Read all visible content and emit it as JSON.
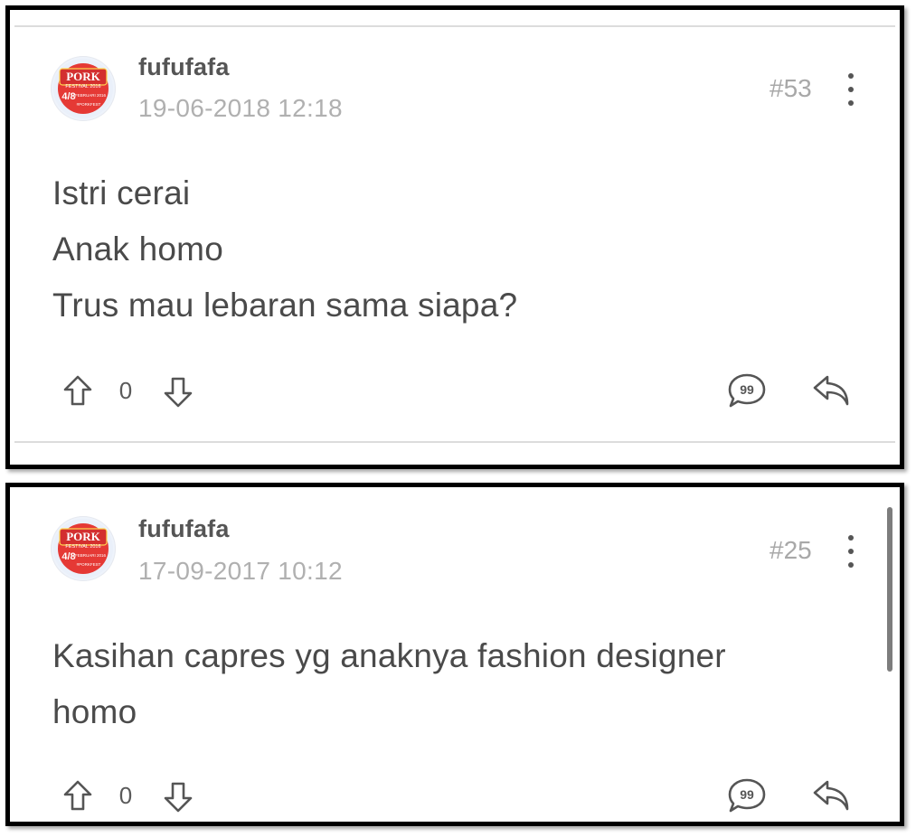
{
  "posts": [
    {
      "username": "fufufafa",
      "timestamp": "19-06-2018 12:18",
      "post_number": "#53",
      "body_lines": [
        "Istri cerai",
        "Anak homo",
        "Trus mau lebaran sama siapa?"
      ],
      "vote_count": "0"
    },
    {
      "username": "fufufafa",
      "timestamp": "17-09-2017 10:12",
      "post_number": "#25",
      "body_lines": [
        "Kasihan capres yg anaknya fashion designer",
        "homo"
      ],
      "vote_count": "0"
    }
  ],
  "avatar_logo": {
    "title": "PORK",
    "subtitle": "FESTIVAL 2016",
    "date": "4/8",
    "month": "FEBRUARI 2016",
    "hashtag": "#PORKFEST"
  },
  "icons": {
    "upvote": "arrow-up-outline-icon",
    "downvote": "arrow-down-outline-icon",
    "quote": "quote-bubble-icon",
    "reply": "reply-arrow-icon",
    "more": "vertical-dots-icon"
  },
  "colors": {
    "frame": "#000000",
    "text": "#4a4a4a",
    "muted": "#b0b0b0",
    "avatar_red": "#e53935"
  }
}
